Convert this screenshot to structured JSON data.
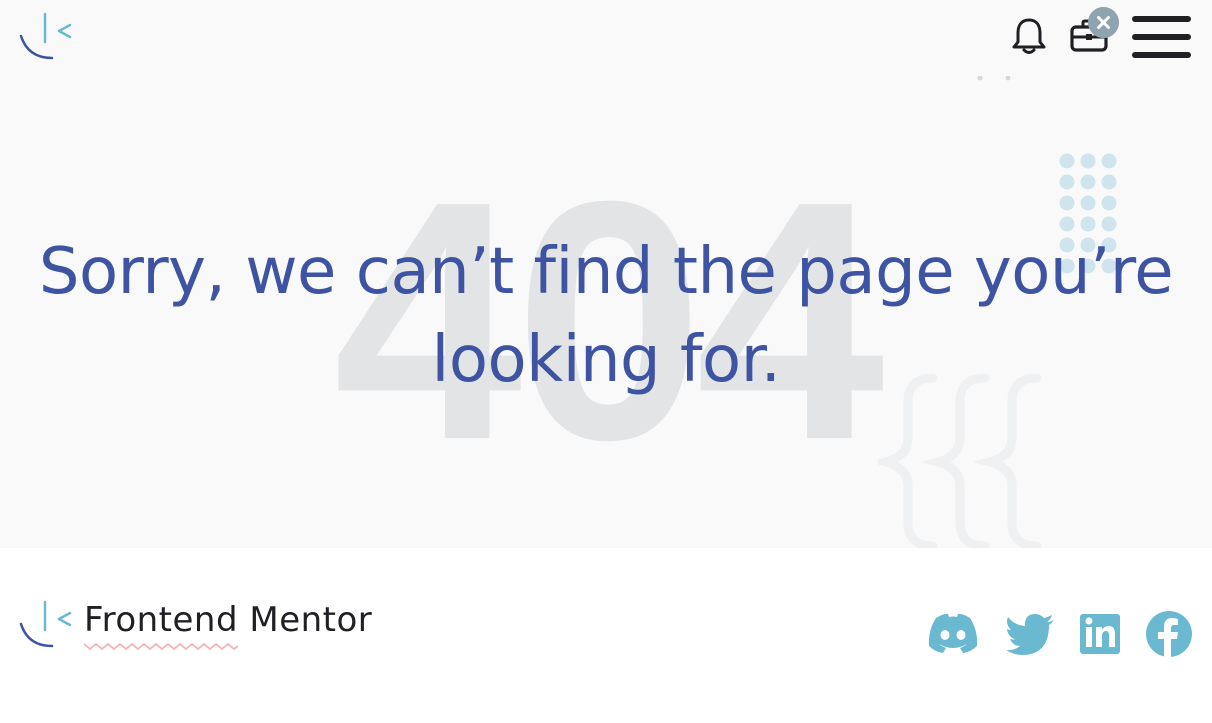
{
  "colors": {
    "accent": "#3e54a3",
    "teal": "#6ab9d0",
    "background_hero": "#f9f9fa",
    "big_404": "#e3e4e6",
    "squiggle": "#f4b8bd",
    "dark": "#1f1f24"
  },
  "header": {
    "logo_icon": "frontend-mentor-logo-icon",
    "notifications_icon": "bell-icon",
    "briefcase_icon": "briefcase-icon",
    "close_badge_icon": "close-icon",
    "menu_icon": "hamburger-menu-icon"
  },
  "main": {
    "background_number": "404",
    "headline_line1": "Sorry, we can’t find the page you’re",
    "headline_line2": "looking for."
  },
  "footer": {
    "brand_name": "Frontend Mentor",
    "social_links": [
      {
        "icon": "discord-icon"
      },
      {
        "icon": "twitter-icon"
      },
      {
        "icon": "linkedin-icon"
      },
      {
        "icon": "facebook-icon"
      }
    ]
  }
}
